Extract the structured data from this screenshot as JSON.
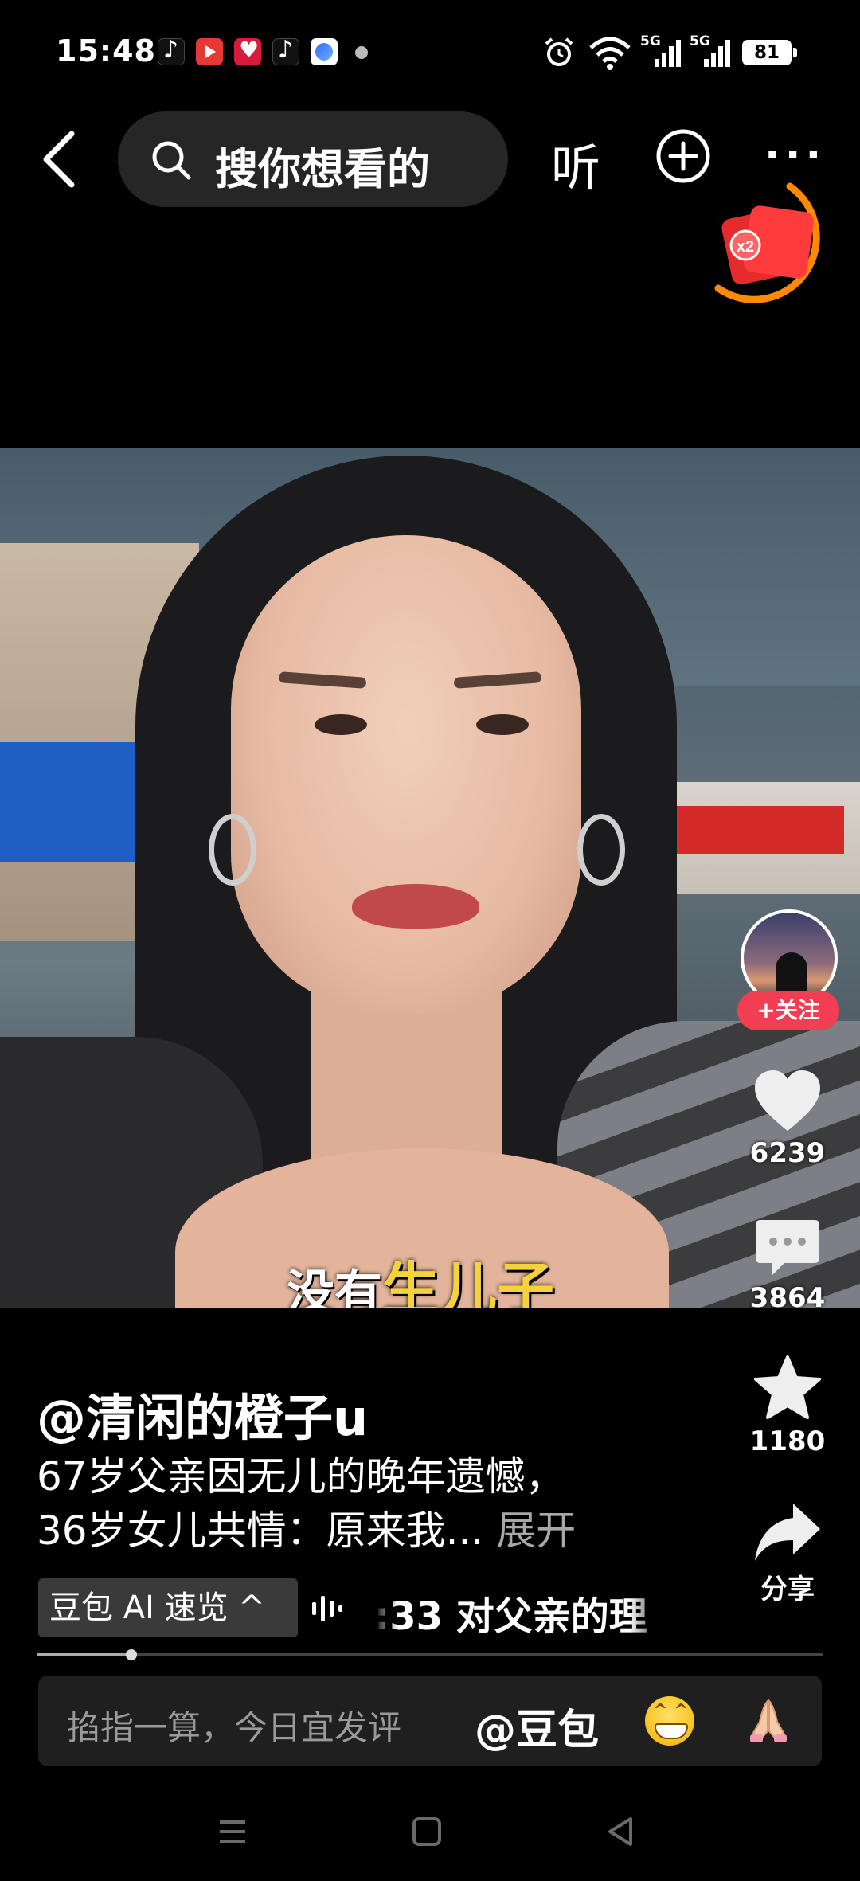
{
  "status_bar": {
    "time": "15:48",
    "signal1_label": "5G",
    "signal2_label": "5G",
    "battery": "81"
  },
  "top_nav": {
    "search_placeholder": "搜你想看的",
    "listen_label": "听"
  },
  "video": {
    "caption_plain": "没有",
    "caption_highlight": "生儿子"
  },
  "creator": {
    "follow_label": "+关注"
  },
  "actions": {
    "likes": "6239",
    "comments": "3864",
    "favorites": "1180",
    "share_label": "分享"
  },
  "post": {
    "author": "@清闲的橙子u",
    "desc_line1": "67岁父亲因无儿的晚年遗憾，",
    "desc_line2": "36岁女儿共情：原来我...",
    "expand_label": "展开",
    "ai_chip_label": "豆包 AI 速览 ^",
    "ai_summary": ":33 对父亲的理",
    "progress": 0.12
  },
  "comment_bar": {
    "placeholder": "掐指一算，今日宜发评",
    "mention": "@豆包"
  },
  "colors": {
    "follow_red": "#f23d52",
    "caption_yellow": "#f3d23a",
    "redpack_ring": "#ff8a00"
  }
}
